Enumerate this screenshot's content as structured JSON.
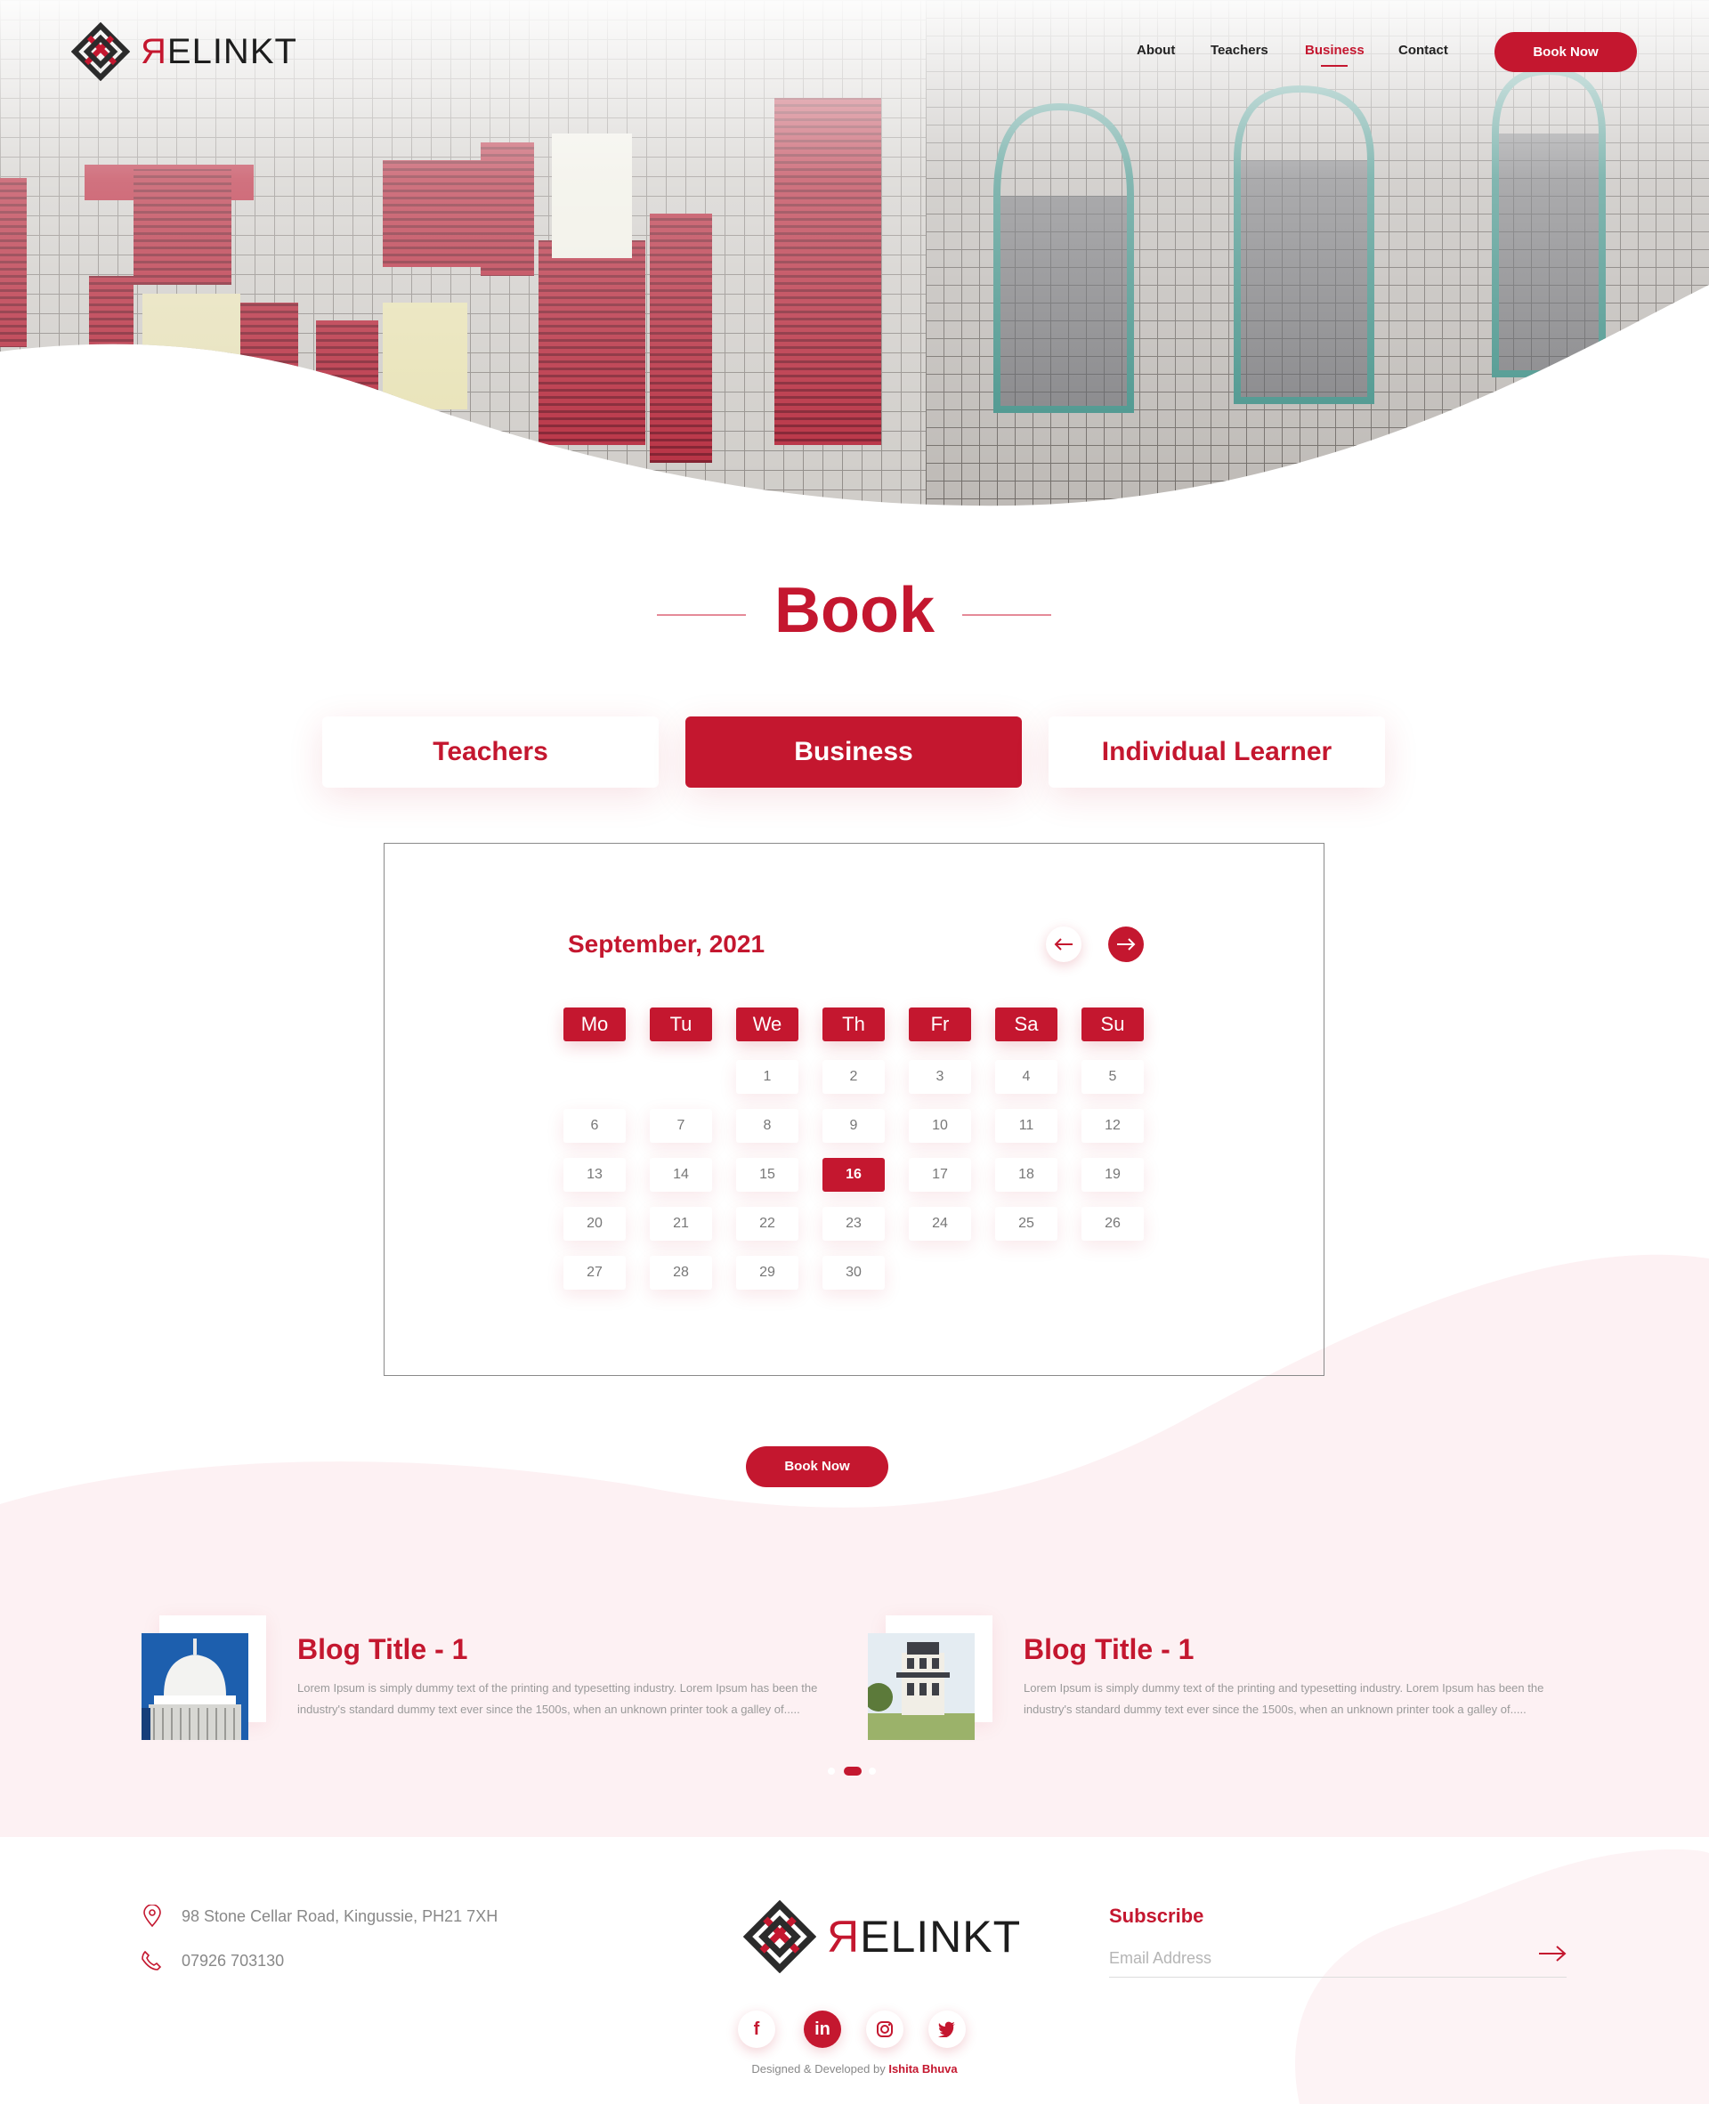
{
  "brand": {
    "name_first": "Я",
    "name_rest": "ELINKT",
    "color": "#c4172f"
  },
  "nav": {
    "items": [
      {
        "label": "About"
      },
      {
        "label": "Teachers"
      },
      {
        "label": "Business"
      },
      {
        "label": "Contact"
      }
    ],
    "active": "Business",
    "cta": "Book Now"
  },
  "book": {
    "title": "Book",
    "tabs": [
      {
        "label": "Teachers"
      },
      {
        "label": "Business"
      },
      {
        "label": "Individual Learner"
      }
    ],
    "active_tab": "Business"
  },
  "calendar": {
    "month": "September, 2021",
    "days_of_week": [
      "Mo",
      "Tu",
      "We",
      "Th",
      "Fr",
      "Sa",
      "Su"
    ],
    "weeks": [
      [
        "",
        "",
        "1",
        "2",
        "3",
        "4",
        "5"
      ],
      [
        "6",
        "7",
        "8",
        "9",
        "10",
        "11",
        "12"
      ],
      [
        "13",
        "14",
        "15",
        "16",
        "17",
        "18",
        "19"
      ],
      [
        "20",
        "21",
        "22",
        "23",
        "24",
        "25",
        "26"
      ],
      [
        "27",
        "28",
        "29",
        "30",
        "",
        "",
        ""
      ]
    ],
    "selected_day": "16",
    "book_button": "Book Now"
  },
  "blog": {
    "posts": [
      {
        "title": "Blog Title - 1",
        "excerpt": "Lorem Ipsum is simply dummy text of the printing and typesetting industry. Lorem Ipsum has been the industry's standard dummy text ever since the 1500s, when an unknown printer took a galley of.....",
        "image": "lighthouse-dome"
      },
      {
        "title": "Blog Title - 1",
        "excerpt": "Lorem Ipsum is simply dummy text of the printing and typesetting industry. Lorem Ipsum has been the industry's standard dummy text ever since the 1500s, when an unknown printer took a galley of.....",
        "image": "victorian-house"
      }
    ],
    "carousel_pages": 3,
    "carousel_active": 2
  },
  "footer": {
    "address": "98 Stone Cellar Road, Kingussie, PH21 7XH",
    "phone": "07926 703130",
    "subscribe_title": "Subscribe",
    "email_placeholder": "Email Address",
    "social": [
      "facebook-icon",
      "linkedin-icon",
      "instagram-icon",
      "twitter-icon"
    ],
    "credit_prefix": "Designed & Developed by",
    "credit_name": "Ishita Bhuva"
  }
}
